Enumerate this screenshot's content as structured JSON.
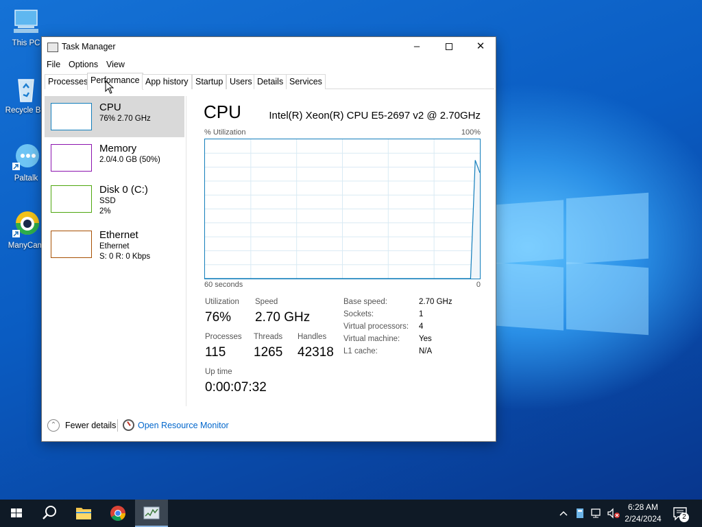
{
  "desktop": {
    "icons": [
      {
        "label": "This PC"
      },
      {
        "label": "Recycle Bin"
      },
      {
        "label": "Paltalk"
      },
      {
        "label": "ManyCam"
      }
    ]
  },
  "window": {
    "title": "Task Manager",
    "menu": [
      "File",
      "Options",
      "View"
    ],
    "tabs": [
      "Processes",
      "Performance",
      "App history",
      "Startup",
      "Users",
      "Details",
      "Services"
    ],
    "active_tab": "Performance"
  },
  "resources": [
    {
      "name": "CPU",
      "line1": "76%  2.70 GHz",
      "line2": "",
      "color": "#117dbb"
    },
    {
      "name": "Memory",
      "line1": "2.0/4.0 GB (50%)",
      "line2": "",
      "color": "#8b12ae"
    },
    {
      "name": "Disk 0 (C:)",
      "line1": "SSD",
      "line2": "2%",
      "color": "#4da60c"
    },
    {
      "name": "Ethernet",
      "line1": "Ethernet",
      "line2": "S: 0  R: 0 Kbps",
      "color": "#a74f01"
    }
  ],
  "cpu": {
    "title": "CPU",
    "model": "Intel(R) Xeon(R) CPU E5-2697 v2 @ 2.70GHz",
    "util_label": "% Utilization",
    "util_max": "100%",
    "time_label": "60 seconds",
    "time_end": "0",
    "graph_color": "#117dbb",
    "history": [
      0,
      0,
      0,
      0,
      0,
      0,
      0,
      0,
      0,
      0,
      0,
      0,
      0,
      0,
      0,
      0,
      0,
      0,
      0,
      0,
      0,
      0,
      0,
      0,
      0,
      0,
      0,
      0,
      0,
      0,
      0,
      0,
      0,
      0,
      0,
      0,
      0,
      0,
      0,
      0,
      0,
      0,
      0,
      0,
      0,
      0,
      0,
      0,
      0,
      0,
      0,
      0,
      0,
      0,
      0,
      0,
      0,
      0,
      85,
      76
    ],
    "stats": {
      "utilization_label": "Utilization",
      "utilization": "76%",
      "speed_label": "Speed",
      "speed": "2.70 GHz",
      "processes_label": "Processes",
      "processes": "115",
      "threads_label": "Threads",
      "threads": "1265",
      "handles_label": "Handles",
      "handles": "42318",
      "uptime_label": "Up time",
      "uptime": "0:00:07:32"
    },
    "details": [
      {
        "k": "Base speed:",
        "v": "2.70 GHz"
      },
      {
        "k": "Sockets:",
        "v": "1"
      },
      {
        "k": "Virtual processors:",
        "v": "4"
      },
      {
        "k": "Virtual machine:",
        "v": "Yes"
      },
      {
        "k": "L1 cache:",
        "v": "N/A"
      }
    ]
  },
  "footer": {
    "fewer_details": "Fewer details",
    "resource_monitor": "Open Resource Monitor"
  },
  "taskbar": {
    "time": "6:28 AM",
    "date": "2/24/2024",
    "notification_count": "2"
  }
}
